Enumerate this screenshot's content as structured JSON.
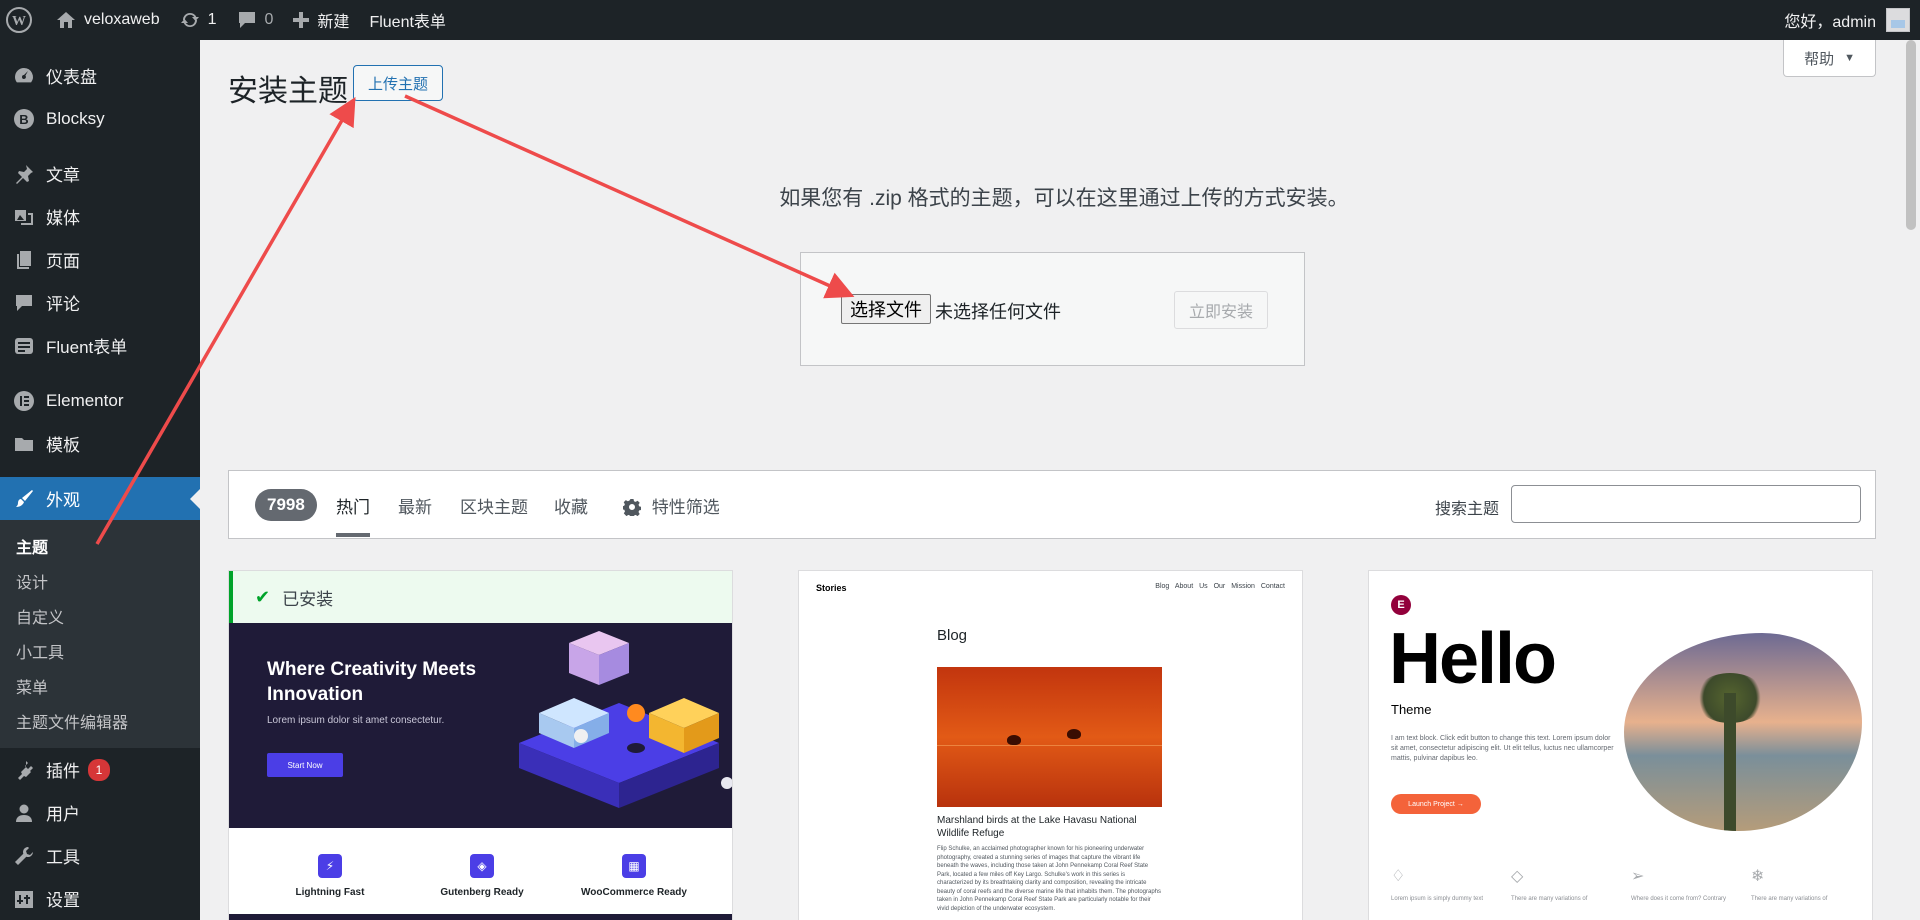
{
  "adminbar": {
    "site_name": "veloxaweb",
    "updates_count": "1",
    "comments_count": "0",
    "new_label": "新建",
    "fluent_label": "Fluent表单",
    "greeting": "您好，admin"
  },
  "sidebar": {
    "items": [
      {
        "label": "仪表盘",
        "icon": "dashboard-icon"
      },
      {
        "label": "Blocksy",
        "icon": "blocksy-icon"
      },
      {
        "label": "文章",
        "icon": "pin-icon"
      },
      {
        "label": "媒体",
        "icon": "media-icon"
      },
      {
        "label": "页面",
        "icon": "page-icon"
      },
      {
        "label": "评论",
        "icon": "comment-icon"
      },
      {
        "label": "Fluent表单",
        "icon": "form-icon"
      },
      {
        "label": "Elementor",
        "icon": "elementor-icon"
      },
      {
        "label": "模板",
        "icon": "folder-icon"
      },
      {
        "label": "外观",
        "icon": "brush-icon"
      },
      {
        "label": "插件",
        "icon": "plugin-icon",
        "badge": "1"
      },
      {
        "label": "用户",
        "icon": "user-icon"
      },
      {
        "label": "工具",
        "icon": "wrench-icon"
      },
      {
        "label": "设置",
        "icon": "settings-icon"
      }
    ],
    "submenu": [
      "主题",
      "设计",
      "自定义",
      "小工具",
      "菜单",
      "主题文件编辑器"
    ]
  },
  "help_label": "帮助",
  "page_title": "安装主题",
  "upload_button": "上传主题",
  "upload_description": "如果您有 .zip 格式的主题，可以在这里通过上传的方式安装。",
  "file_button": "选择文件",
  "file_status": "未选择任何文件",
  "install_button": "立即安装",
  "filter": {
    "count": "7998",
    "tabs": [
      "热门",
      "最新",
      "区块主题",
      "收藏",
      "特性筛选"
    ],
    "search_label": "搜索主题",
    "search_value": ""
  },
  "themes": {
    "blocksy": {
      "installed": "已安装",
      "headline": "Where Creativity Meets Innovation",
      "lorem": "Lorem ipsum dolor sit amet consectetur.",
      "cta": "Start Now",
      "features": [
        "Lightning Fast",
        "Gutenberg Ready",
        "WooCommerce Ready"
      ]
    },
    "stories": {
      "brand": "Stories",
      "nav": "Blog About Us Our Mission Contact",
      "blog": "Blog",
      "caption": "Marshland birds at the Lake Havasu National Wildlife Refuge",
      "body": "Flip Schulke, an acclaimed photographer known for his pioneering underwater photography, created a stunning series of images that capture the vibrant life beneath the waves, including those taken at John Pennekamp Coral Reef State Park, located a few miles off Key Largo. Schulke's work in this series is characterized by its breathtaking clarity and composition, revealing the intricate beauty of coral reefs and the diverse marine life that inhabits them. The photographs taken in John Pennekamp Coral Reef State Park are particularly notable for their vivid depiction of the underwater ecosystem."
    },
    "hello": {
      "logo": "E",
      "title": "Hello",
      "subtitle": "Theme",
      "text": "I am text block. Click edit button to change this text. Lorem ipsum dolor sit amet, consectetur adipiscing elit. Ut elit tellus, luctus nec ullamcorper mattis, pulvinar dapibus leo.",
      "button": "Launch Project →",
      "icon_texts": [
        "Lorem ipsum is simply dummy text",
        "There are many variations of",
        "Where does it come from? Contrary",
        "There are many variations of"
      ]
    }
  },
  "colors": {
    "accent": "#2271b1",
    "sidebar_bg": "#1d2327",
    "annotation": "#ee4b4b"
  }
}
